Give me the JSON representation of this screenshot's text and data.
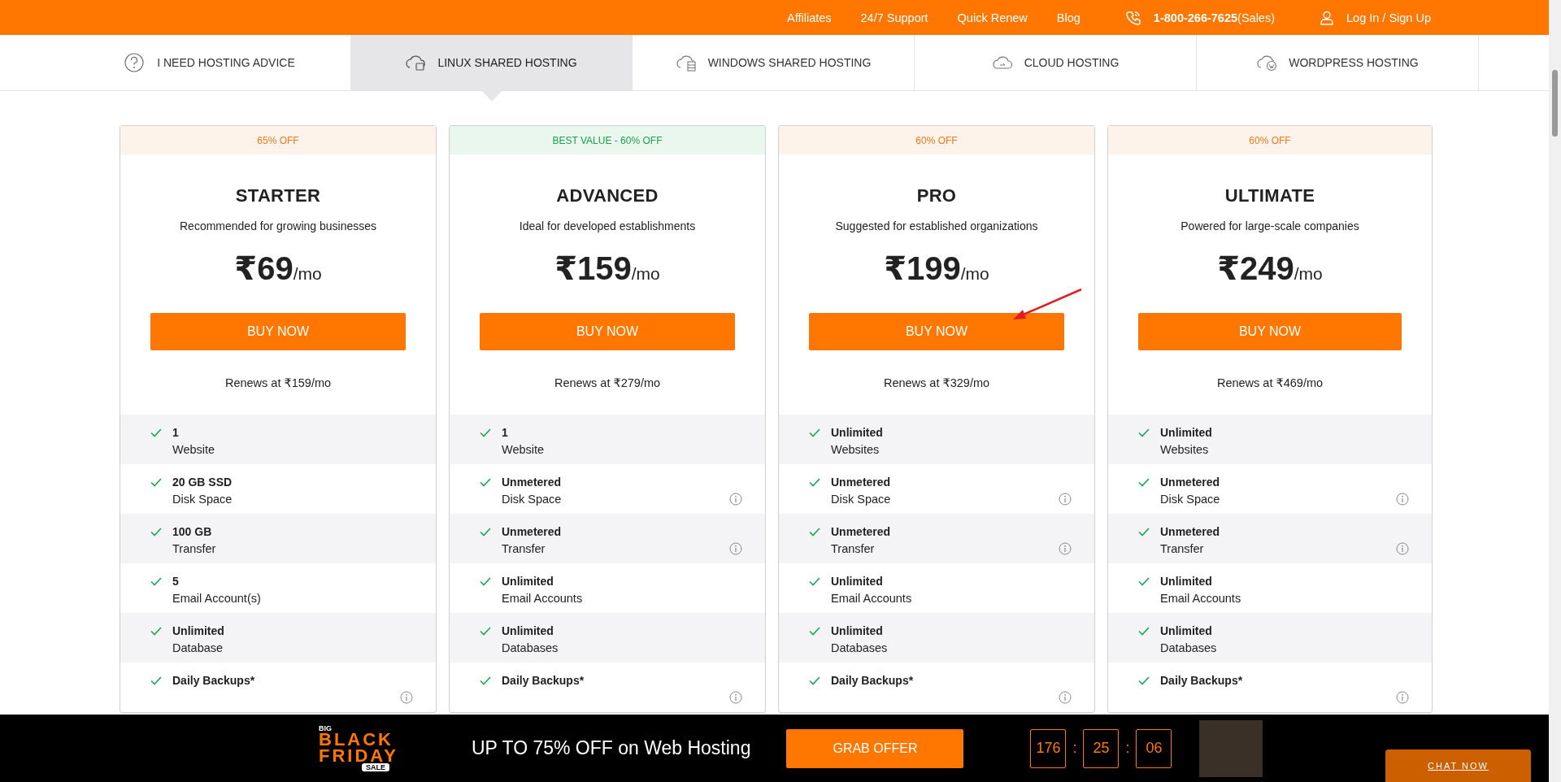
{
  "top_bar": {
    "links": [
      "Affiliates",
      "24/7 Support",
      "Quick Renew",
      "Blog"
    ],
    "phone": "1-800-266-7625",
    "phone_note": "(Sales)",
    "login": "Log In / Sign Up"
  },
  "tabs": [
    {
      "label": "I NEED HOSTING ADVICE",
      "kind": "question",
      "selected": false
    },
    {
      "label": "LINUX SHARED HOSTING",
      "kind": "linux",
      "selected": true
    },
    {
      "label": "WINDOWS SHARED HOSTING",
      "kind": "windows",
      "selected": false
    },
    {
      "label": "CLOUD HOSTING",
      "kind": "cloud",
      "selected": false
    },
    {
      "label": "WORDPRESS HOSTING",
      "kind": "wordpress",
      "selected": false
    }
  ],
  "plans": [
    {
      "badge": "65% OFF",
      "best_value": false,
      "name": "STARTER",
      "description": "Recommended for growing businesses",
      "price": "₹69",
      "period": "/mo",
      "button": "BUY NOW",
      "renews": "Renews at ₹159/mo",
      "features": [
        {
          "value": "1",
          "label": "Website",
          "info": false
        },
        {
          "value": "20 GB SSD",
          "label": "Disk Space",
          "info": false
        },
        {
          "value": "100 GB",
          "label": "Transfer",
          "info": false
        },
        {
          "value": "5",
          "label": "Email Account(s)",
          "info": false
        },
        {
          "value": "Unlimited",
          "label": "Database",
          "info": false
        },
        {
          "value": "Daily Backups*",
          "info": true
        }
      ]
    },
    {
      "badge": "BEST VALUE - 60% OFF",
      "best_value": true,
      "name": "ADVANCED",
      "description": "Ideal for developed establishments",
      "price": "₹159",
      "period": "/mo",
      "button": "BUY NOW",
      "renews": "Renews at ₹279/mo",
      "features": [
        {
          "value": "1",
          "label": "Website",
          "info": false
        },
        {
          "value": "Unmetered",
          "label": "Disk Space",
          "info": true
        },
        {
          "value": "Unmetered",
          "label": "Transfer",
          "info": true
        },
        {
          "value": "Unlimited",
          "label": "Email Accounts",
          "info": false
        },
        {
          "value": "Unlimited",
          "label": "Databases",
          "info": false
        },
        {
          "value": "Daily Backups*",
          "info": true
        }
      ]
    },
    {
      "badge": "60% OFF",
      "best_value": false,
      "name": "PRO",
      "description": "Suggested for established organizations",
      "price": "₹199",
      "period": "/mo",
      "button": "BUY NOW",
      "renews": "Renews at ₹329/mo",
      "features": [
        {
          "value": "Unlimited",
          "label": "Websites",
          "info": false
        },
        {
          "value": "Unmetered",
          "label": "Disk Space",
          "info": true
        },
        {
          "value": "Unmetered",
          "label": "Transfer",
          "info": true
        },
        {
          "value": "Unlimited",
          "label": "Email Accounts",
          "info": false
        },
        {
          "value": "Unlimited",
          "label": "Databases",
          "info": false
        },
        {
          "value": "Daily Backups*",
          "info": true
        }
      ]
    },
    {
      "badge": "60% OFF",
      "best_value": false,
      "name": "ULTIMATE",
      "description": "Powered for large-scale companies",
      "price": "₹249",
      "period": "/mo",
      "button": "BUY NOW",
      "renews": "Renews at ₹469/mo",
      "features": [
        {
          "value": "Unlimited",
          "label": "Websites",
          "info": false
        },
        {
          "value": "Unmetered",
          "label": "Disk Space",
          "info": true
        },
        {
          "value": "Unmetered",
          "label": "Transfer",
          "info": true
        },
        {
          "value": "Unlimited",
          "label": "Email Accounts",
          "info": false
        },
        {
          "value": "Unlimited",
          "label": "Databases",
          "info": false
        },
        {
          "value": "Daily Backups*",
          "info": true
        }
      ]
    }
  ],
  "promo": {
    "logo": [
      "BIG",
      "BLACK",
      "FRIDAY",
      "SALE"
    ],
    "headline": "UP TO 75% OFF on Web Hosting",
    "button": "GRAB OFFER",
    "countdown": [
      "176",
      "25",
      "06"
    ],
    "separator": ":",
    "chat": "CHAT NOW"
  }
}
